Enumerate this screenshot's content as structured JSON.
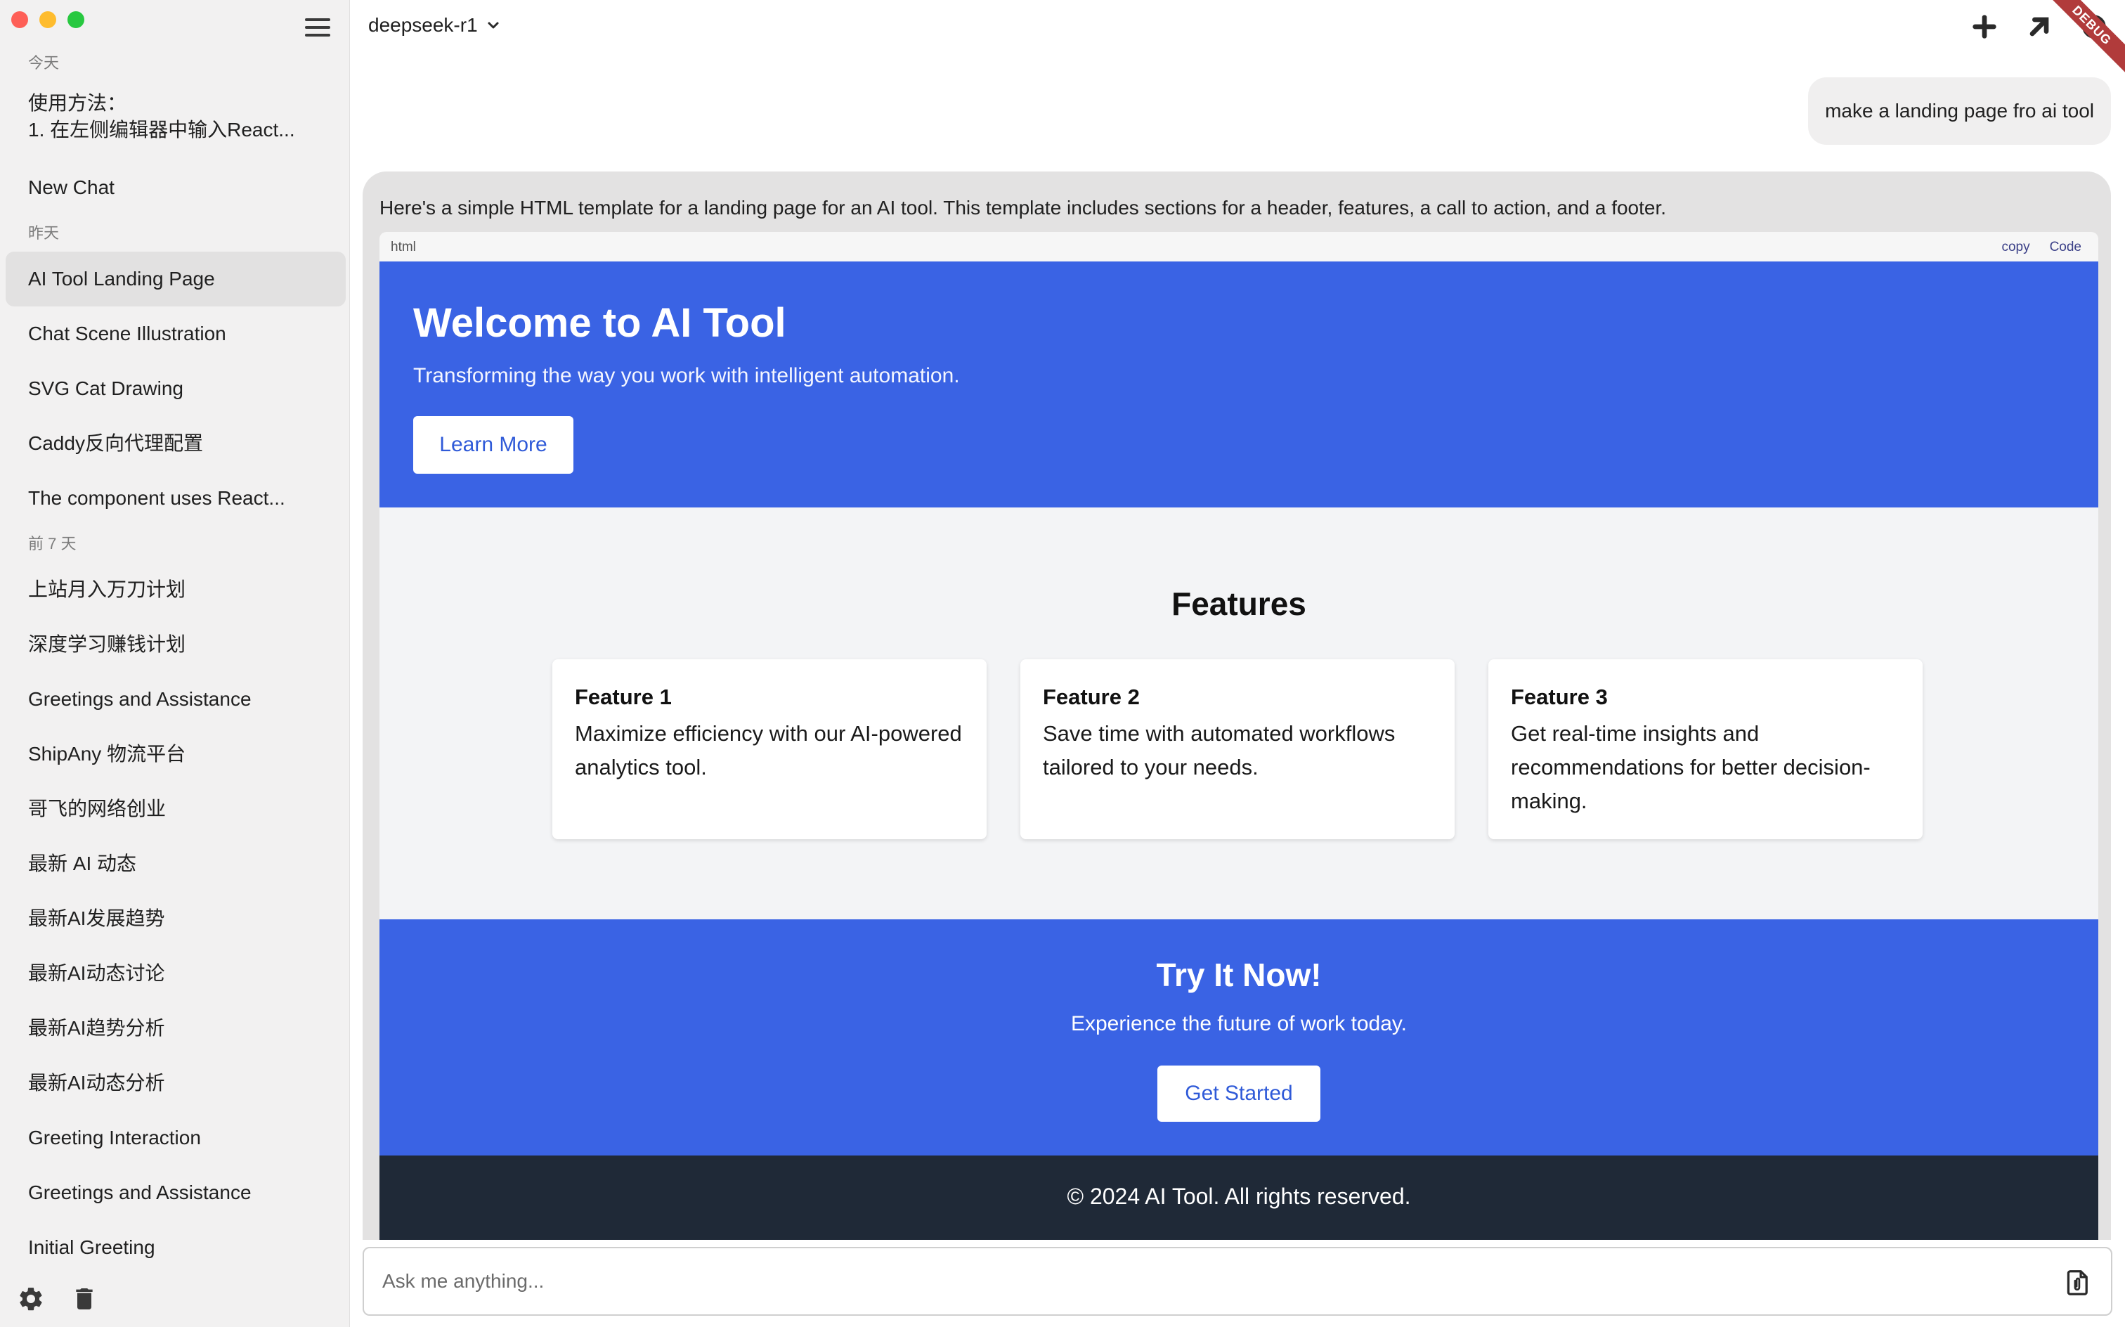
{
  "sidebar": {
    "groups": [
      {
        "label": "今天",
        "items": [
          {
            "label_lines": [
              "使用方法：",
              "1. 在左侧编辑器中输入React..."
            ]
          },
          {
            "label": "New Chat"
          }
        ]
      },
      {
        "label": "昨天",
        "items": [
          {
            "label": "AI Tool Landing Page",
            "active": true
          },
          {
            "label": "Chat Scene Illustration"
          },
          {
            "label": "SVG Cat Drawing"
          },
          {
            "label": "Caddy反向代理配置"
          },
          {
            "label": "The component uses React..."
          }
        ]
      },
      {
        "label": "前 7 天",
        "items": [
          {
            "label": "上站月入万刀计划"
          },
          {
            "label": "深度学习赚钱计划"
          },
          {
            "label": "Greetings and Assistance"
          },
          {
            "label": "ShipAny 物流平台"
          },
          {
            "label": "哥飞的网络创业"
          },
          {
            "label": "最新 AI 动态"
          },
          {
            "label": "最新AI发展趋势"
          },
          {
            "label": "最新AI动态讨论"
          },
          {
            "label": "最新AI趋势分析"
          },
          {
            "label": "最新AI动态分析"
          },
          {
            "label": "Greeting Interaction"
          },
          {
            "label": "Greetings and Assistance"
          },
          {
            "label": "Initial Greeting"
          }
        ]
      }
    ],
    "footer_icons": [
      "gear-icon",
      "trash-icon"
    ]
  },
  "header": {
    "model": "deepseek-r1",
    "actions": [
      "plus-icon",
      "arrow-up-right-icon",
      "gear-icon"
    ],
    "debug_label": "DEBUG"
  },
  "conversation": {
    "user_message": "make a landing page fro ai tool",
    "assistant_intro": "Here's a simple HTML template for a landing page for an AI tool. This template includes sections for a header, features, a call to action, and a footer.",
    "code_block": {
      "lang": "html",
      "copy_label": "copy",
      "code_label": "Code"
    }
  },
  "preview": {
    "hero": {
      "title": "Welcome to AI Tool",
      "subtitle": "Transforming the way you work with intelligent automation.",
      "button": "Learn More"
    },
    "features": {
      "title": "Features",
      "cards": [
        {
          "title": "Feature 1",
          "desc": "Maximize efficiency with our AI-powered analytics tool."
        },
        {
          "title": "Feature 2",
          "desc": "Save time with automated workflows tailored to your needs."
        },
        {
          "title": "Feature 3",
          "desc": "Get real-time insights and recommendations for better decision-making."
        }
      ]
    },
    "cta": {
      "title": "Try It Now!",
      "subtitle": "Experience the future of work today.",
      "button": "Get Started"
    },
    "footer": "© 2024 AI Tool. All rights reserved.",
    "colors": {
      "primary": "#3a63e4",
      "background": "#f3f4f6",
      "footer": "#1f2937"
    }
  },
  "composer": {
    "placeholder": "Ask me anything..."
  }
}
